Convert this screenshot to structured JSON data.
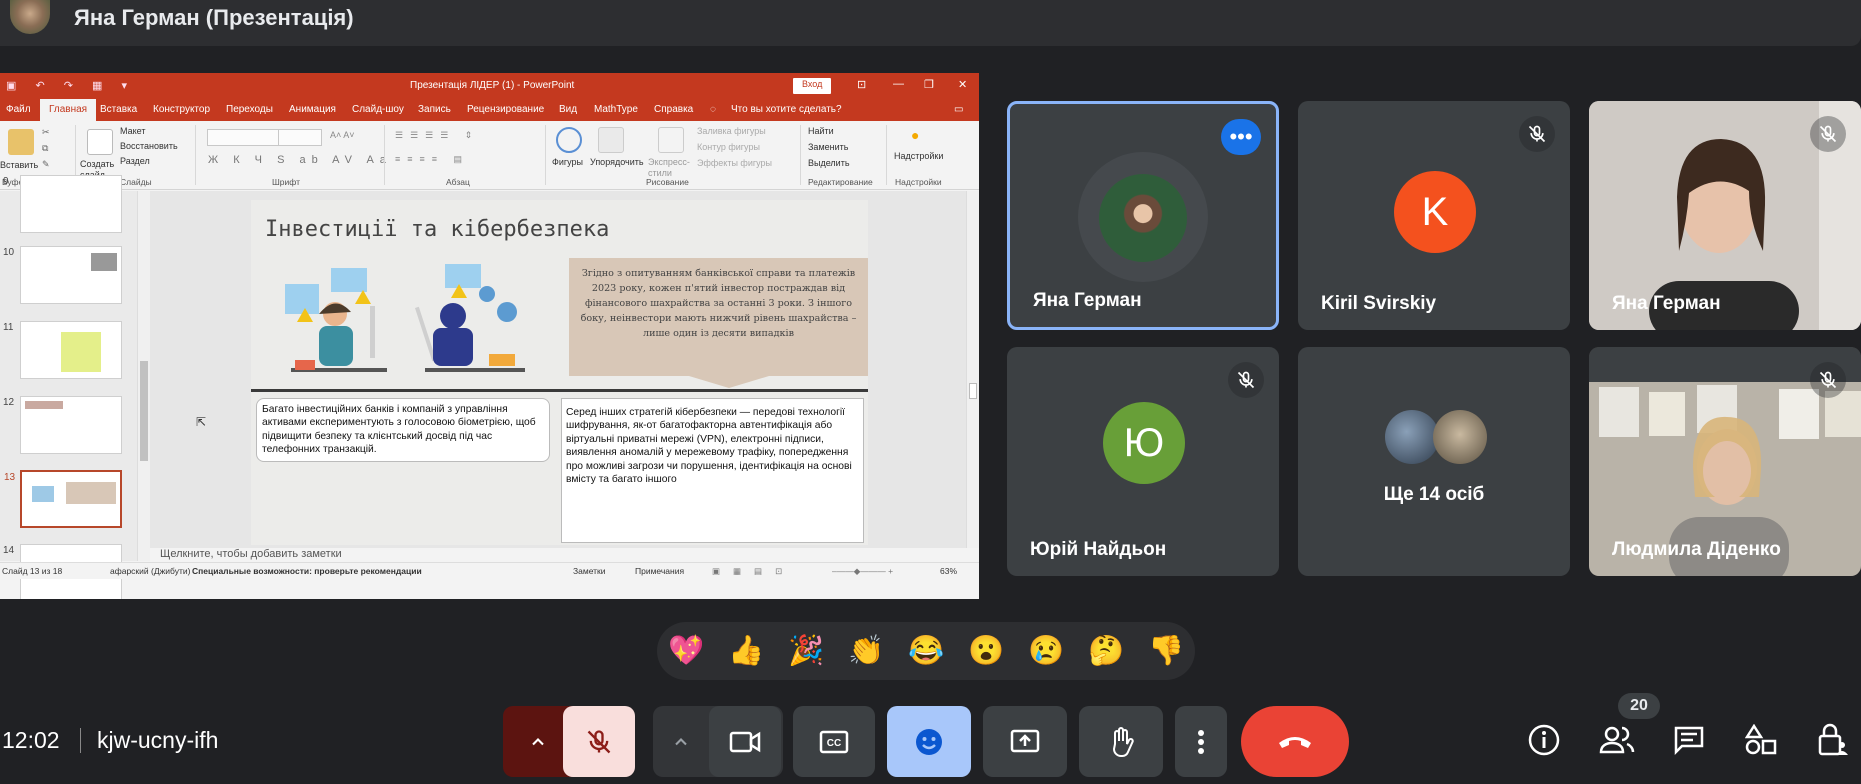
{
  "presenter_bar": {
    "title": "Яна Герман (Презентація)"
  },
  "powerpoint": {
    "window_title": "Презентація ЛІДЕР (1)  -  PowerPoint",
    "login_label": "Вход",
    "tabs": [
      "Файл",
      "Главная",
      "Вставка",
      "Конструктор",
      "Переходы",
      "Анимация",
      "Слайд-шоу",
      "Запись",
      "Рецензирование",
      "Вид",
      "MathType",
      "Справка"
    ],
    "tell_me": "Что вы хотите сделать?",
    "ribbon": {
      "paste": "Вставить",
      "new_slide": "Создать слайд",
      "layout": "Макет",
      "reset": "Восстановить",
      "section": "Раздел",
      "shapes": "Фигуры",
      "arrange": "Упорядочить",
      "quick_styles": "Экспресс-стили",
      "shape_fill": "Заливка фигуры",
      "shape_outline": "Контур фигуры",
      "shape_effects": "Эффекты фигуры",
      "find": "Найти",
      "replace": "Заменить",
      "select": "Выделить",
      "addins": "Надстройки",
      "groups": [
        "Буфер обмена",
        "Слайды",
        "Шрифт",
        "Абзац",
        "Рисование",
        "Редактирование",
        "Надстройки"
      ]
    },
    "thumb_numbers": [
      "9",
      "10",
      "11",
      "12",
      "13",
      "14"
    ],
    "slide": {
      "title": "Інвестиції та кібербезпека",
      "beige_text": "Згідно з опитуванням банківської справи та платежів 2023 року, кожен п'ятий інвестор постраждав від фінансового шахрайства за останні 3 роки. З іншого боку, неінвестори мають нижчий рівень шахрайства – лише один із десяти випадків",
      "box1": "Багато інвестиційних банків і компаній з управління активами експериментують з голосовою біометрією, щоб підвищити безпеку та клієнтський досвід під час телефонних транзакцій.",
      "box2": "Серед інших стратегій кібербезпеки — передові технології шифрування, як-от багатофакторна автентифікація або віртуальні приватні мережі (VPN), електронні підписи, виявлення аномалій у мережевому трафіку, попередження про можливі загрози чи порушення, ідентифікація на основі вмісту та багато іншого"
    },
    "notes_placeholder": "Щелкните, чтобы добавить заметки",
    "status": {
      "slide_counter": "Слайд 13 из 18",
      "language": "афарский (Джибути)",
      "accessibility": "Специальные возможности: проверьте рекомендации",
      "notes": "Заметки",
      "comments": "Примечания",
      "zoom": "63%"
    }
  },
  "participants": [
    {
      "name": "Яна Герман",
      "type": "photo-avatar"
    },
    {
      "name": "Kiril Svirskiy",
      "letter": "K",
      "color": "#f4511e"
    },
    {
      "name": "Яна Герман",
      "type": "video"
    },
    {
      "name": "Юрій Найдьон",
      "letter": "Ю",
      "color": "#689f38"
    },
    {
      "name": "Ще 14 осіб",
      "type": "others"
    },
    {
      "name": "Людмила Діденко",
      "type": "video"
    }
  ],
  "reactions": [
    "💖",
    "👍",
    "🎉",
    "👏",
    "😂",
    "😮",
    "😢",
    "🤔",
    "👎"
  ],
  "bottom_bar": {
    "time": "12:02",
    "meeting_code": "kjw-ucny-ifh",
    "people_count": "20"
  },
  "colors": {
    "accent": "#8ab4f8",
    "end_call": "#ea4335",
    "mic_off": "#f9dedc",
    "ppt": "#c4391f"
  }
}
